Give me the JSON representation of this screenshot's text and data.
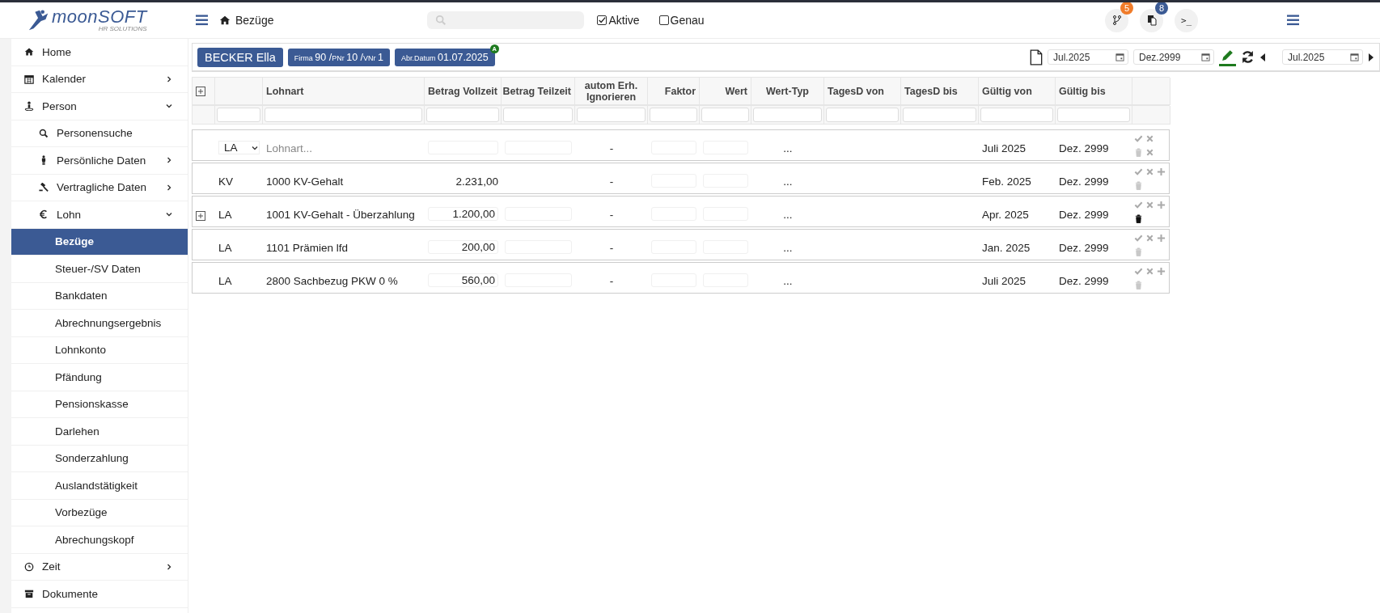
{
  "logo": {
    "name": "moonSOFT",
    "tagline": "HR SOLUTIONS"
  },
  "breadcrumb": "Bezüge",
  "filters": [
    {
      "label": "Aktive",
      "checked": true
    },
    {
      "label": "Genau",
      "checked": false
    }
  ],
  "top_actions": [
    {
      "kind": "branch",
      "badge": "5",
      "color": "#f07c2a"
    },
    {
      "kind": "copy",
      "badge": "8",
      "color": "#3b5a94"
    },
    {
      "kind": "terminal",
      "text": ">_"
    }
  ],
  "sidebar": {
    "items": [
      {
        "label": "Home",
        "selected": false
      },
      {
        "label": "Kalender",
        "selected": false,
        "expanded": false
      },
      {
        "label": "Person",
        "selected": false,
        "expanded": true,
        "children": [
          {
            "label": "Personensuche",
            "selected": false
          },
          {
            "label": "Persönliche Daten",
            "selected": false,
            "expanded": false
          },
          {
            "label": "Vertragliche Daten",
            "selected": false,
            "expanded": false
          },
          {
            "label": "Lohn",
            "selected": false,
            "expanded": true,
            "children": [
              {
                "label": "Bezüge",
                "selected": true
              },
              {
                "label": "Steuer-/SV Daten",
                "selected": false
              },
              {
                "label": "Bankdaten",
                "selected": false
              },
              {
                "label": "Abrechnungsergebnis",
                "selected": false
              },
              {
                "label": "Lohnkonto",
                "selected": false
              },
              {
                "label": "Pfändung",
                "selected": false
              },
              {
                "label": "Pensionskasse",
                "selected": false
              },
              {
                "label": "Darlehen",
                "selected": false
              },
              {
                "label": "Sonderzahlung",
                "selected": false
              },
              {
                "label": "Auslandstätigkeit",
                "selected": false
              },
              {
                "label": "Vorbezüge",
                "selected": false
              },
              {
                "label": "Abrechungskopf",
                "selected": false
              }
            ]
          }
        ]
      },
      {
        "label": "Zeit",
        "selected": false,
        "expanded": false
      },
      {
        "label": "Dokumente",
        "selected": false
      }
    ]
  },
  "employee": {
    "name": "BECKER Ella",
    "ids": [
      {
        "label": "Firma",
        "value": "90 /"
      },
      {
        "label": "PNr",
        "value": "10 /"
      },
      {
        "label": "VNr",
        "value": "1"
      }
    ],
    "date_label": "Abr.Datum",
    "date": "01.07.2025",
    "date_badge": "A"
  },
  "toolbar": {
    "from": "Jul.2025",
    "to": "Dez.2999",
    "edit_active": true,
    "period": "Jul.2025"
  },
  "table": {
    "columns": [
      "Lohnart",
      "Betrag Vollzeit",
      "Betrag Teilzeit",
      "autom Erh. Ignorieren",
      "Faktor",
      "Wert",
      "Wert-Typ",
      "TagesD von",
      "TagesD bis",
      "Gültig von",
      "Gültig bis"
    ],
    "rows": [
      {
        "kind": "new",
        "type": "LA",
        "placeholder": "Lohnart...",
        "autom": "-",
        "wert_typ": "...",
        "valid_from": "Juli 2025",
        "valid_to": "Dez. 2999"
      },
      {
        "kind": "entry",
        "expandable": false,
        "type": "KV",
        "lohnart": "1000 KV-Gehalt",
        "betrag": "2.231,00",
        "boxed": false,
        "autom": "-",
        "wert_typ": "...",
        "valid_from": "Feb. 2025",
        "valid_to": "Dez. 2999",
        "delete_enabled": false
      },
      {
        "kind": "entry",
        "expandable": true,
        "type": "LA",
        "lohnart": "1001 KV-Gehalt - Überzahlung",
        "betrag": "1.200,00",
        "boxed": true,
        "autom": "-",
        "wert_typ": "...",
        "valid_from": "Apr. 2025",
        "valid_to": "Dez. 2999",
        "delete_enabled": true
      },
      {
        "kind": "entry",
        "expandable": false,
        "type": "LA",
        "lohnart": "1101 Prämien lfd",
        "betrag": "200,00",
        "boxed": true,
        "autom": "-",
        "wert_typ": "...",
        "valid_from": "Jan. 2025",
        "valid_to": "Dez. 2999",
        "delete_enabled": false
      },
      {
        "kind": "entry",
        "expandable": false,
        "type": "LA",
        "lohnart": "2800 Sachbezug PKW 0 %",
        "betrag": "560,00",
        "boxed": true,
        "autom": "-",
        "wert_typ": "...",
        "valid_from": "Juli 2025",
        "valid_to": "Dez. 2999",
        "delete_enabled": false
      }
    ]
  }
}
